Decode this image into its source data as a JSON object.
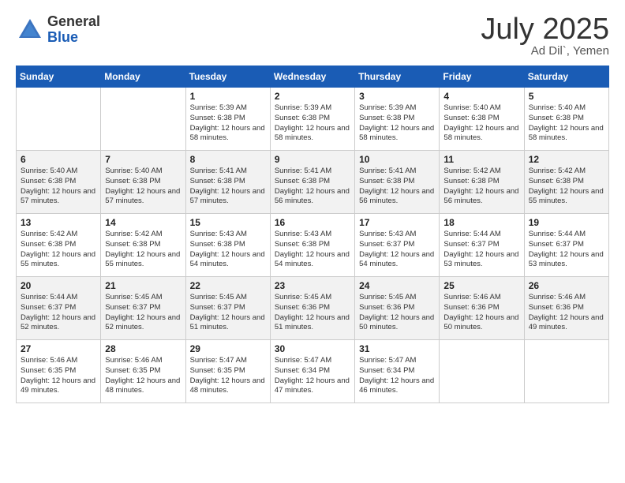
{
  "logo": {
    "general": "General",
    "blue": "Blue"
  },
  "header": {
    "month": "July 2025",
    "location": "Ad Dil`, Yemen"
  },
  "days_of_week": [
    "Sunday",
    "Monday",
    "Tuesday",
    "Wednesday",
    "Thursday",
    "Friday",
    "Saturday"
  ],
  "weeks": [
    [
      {
        "day": "",
        "sunrise": "",
        "sunset": "",
        "daylight": ""
      },
      {
        "day": "",
        "sunrise": "",
        "sunset": "",
        "daylight": ""
      },
      {
        "day": "1",
        "sunrise": "Sunrise: 5:39 AM",
        "sunset": "Sunset: 6:38 PM",
        "daylight": "Daylight: 12 hours and 58 minutes."
      },
      {
        "day": "2",
        "sunrise": "Sunrise: 5:39 AM",
        "sunset": "Sunset: 6:38 PM",
        "daylight": "Daylight: 12 hours and 58 minutes."
      },
      {
        "day": "3",
        "sunrise": "Sunrise: 5:39 AM",
        "sunset": "Sunset: 6:38 PM",
        "daylight": "Daylight: 12 hours and 58 minutes."
      },
      {
        "day": "4",
        "sunrise": "Sunrise: 5:40 AM",
        "sunset": "Sunset: 6:38 PM",
        "daylight": "Daylight: 12 hours and 58 minutes."
      },
      {
        "day": "5",
        "sunrise": "Sunrise: 5:40 AM",
        "sunset": "Sunset: 6:38 PM",
        "daylight": "Daylight: 12 hours and 58 minutes."
      }
    ],
    [
      {
        "day": "6",
        "sunrise": "Sunrise: 5:40 AM",
        "sunset": "Sunset: 6:38 PM",
        "daylight": "Daylight: 12 hours and 57 minutes."
      },
      {
        "day": "7",
        "sunrise": "Sunrise: 5:40 AM",
        "sunset": "Sunset: 6:38 PM",
        "daylight": "Daylight: 12 hours and 57 minutes."
      },
      {
        "day": "8",
        "sunrise": "Sunrise: 5:41 AM",
        "sunset": "Sunset: 6:38 PM",
        "daylight": "Daylight: 12 hours and 57 minutes."
      },
      {
        "day": "9",
        "sunrise": "Sunrise: 5:41 AM",
        "sunset": "Sunset: 6:38 PM",
        "daylight": "Daylight: 12 hours and 56 minutes."
      },
      {
        "day": "10",
        "sunrise": "Sunrise: 5:41 AM",
        "sunset": "Sunset: 6:38 PM",
        "daylight": "Daylight: 12 hours and 56 minutes."
      },
      {
        "day": "11",
        "sunrise": "Sunrise: 5:42 AM",
        "sunset": "Sunset: 6:38 PM",
        "daylight": "Daylight: 12 hours and 56 minutes."
      },
      {
        "day": "12",
        "sunrise": "Sunrise: 5:42 AM",
        "sunset": "Sunset: 6:38 PM",
        "daylight": "Daylight: 12 hours and 55 minutes."
      }
    ],
    [
      {
        "day": "13",
        "sunrise": "Sunrise: 5:42 AM",
        "sunset": "Sunset: 6:38 PM",
        "daylight": "Daylight: 12 hours and 55 minutes."
      },
      {
        "day": "14",
        "sunrise": "Sunrise: 5:42 AM",
        "sunset": "Sunset: 6:38 PM",
        "daylight": "Daylight: 12 hours and 55 minutes."
      },
      {
        "day": "15",
        "sunrise": "Sunrise: 5:43 AM",
        "sunset": "Sunset: 6:38 PM",
        "daylight": "Daylight: 12 hours and 54 minutes."
      },
      {
        "day": "16",
        "sunrise": "Sunrise: 5:43 AM",
        "sunset": "Sunset: 6:38 PM",
        "daylight": "Daylight: 12 hours and 54 minutes."
      },
      {
        "day": "17",
        "sunrise": "Sunrise: 5:43 AM",
        "sunset": "Sunset: 6:37 PM",
        "daylight": "Daylight: 12 hours and 54 minutes."
      },
      {
        "day": "18",
        "sunrise": "Sunrise: 5:44 AM",
        "sunset": "Sunset: 6:37 PM",
        "daylight": "Daylight: 12 hours and 53 minutes."
      },
      {
        "day": "19",
        "sunrise": "Sunrise: 5:44 AM",
        "sunset": "Sunset: 6:37 PM",
        "daylight": "Daylight: 12 hours and 53 minutes."
      }
    ],
    [
      {
        "day": "20",
        "sunrise": "Sunrise: 5:44 AM",
        "sunset": "Sunset: 6:37 PM",
        "daylight": "Daylight: 12 hours and 52 minutes."
      },
      {
        "day": "21",
        "sunrise": "Sunrise: 5:45 AM",
        "sunset": "Sunset: 6:37 PM",
        "daylight": "Daylight: 12 hours and 52 minutes."
      },
      {
        "day": "22",
        "sunrise": "Sunrise: 5:45 AM",
        "sunset": "Sunset: 6:37 PM",
        "daylight": "Daylight: 12 hours and 51 minutes."
      },
      {
        "day": "23",
        "sunrise": "Sunrise: 5:45 AM",
        "sunset": "Sunset: 6:36 PM",
        "daylight": "Daylight: 12 hours and 51 minutes."
      },
      {
        "day": "24",
        "sunrise": "Sunrise: 5:45 AM",
        "sunset": "Sunset: 6:36 PM",
        "daylight": "Daylight: 12 hours and 50 minutes."
      },
      {
        "day": "25",
        "sunrise": "Sunrise: 5:46 AM",
        "sunset": "Sunset: 6:36 PM",
        "daylight": "Daylight: 12 hours and 50 minutes."
      },
      {
        "day": "26",
        "sunrise": "Sunrise: 5:46 AM",
        "sunset": "Sunset: 6:36 PM",
        "daylight": "Daylight: 12 hours and 49 minutes."
      }
    ],
    [
      {
        "day": "27",
        "sunrise": "Sunrise: 5:46 AM",
        "sunset": "Sunset: 6:35 PM",
        "daylight": "Daylight: 12 hours and 49 minutes."
      },
      {
        "day": "28",
        "sunrise": "Sunrise: 5:46 AM",
        "sunset": "Sunset: 6:35 PM",
        "daylight": "Daylight: 12 hours and 48 minutes."
      },
      {
        "day": "29",
        "sunrise": "Sunrise: 5:47 AM",
        "sunset": "Sunset: 6:35 PM",
        "daylight": "Daylight: 12 hours and 48 minutes."
      },
      {
        "day": "30",
        "sunrise": "Sunrise: 5:47 AM",
        "sunset": "Sunset: 6:34 PM",
        "daylight": "Daylight: 12 hours and 47 minutes."
      },
      {
        "day": "31",
        "sunrise": "Sunrise: 5:47 AM",
        "sunset": "Sunset: 6:34 PM",
        "daylight": "Daylight: 12 hours and 46 minutes."
      },
      {
        "day": "",
        "sunrise": "",
        "sunset": "",
        "daylight": ""
      },
      {
        "day": "",
        "sunrise": "",
        "sunset": "",
        "daylight": ""
      }
    ]
  ]
}
